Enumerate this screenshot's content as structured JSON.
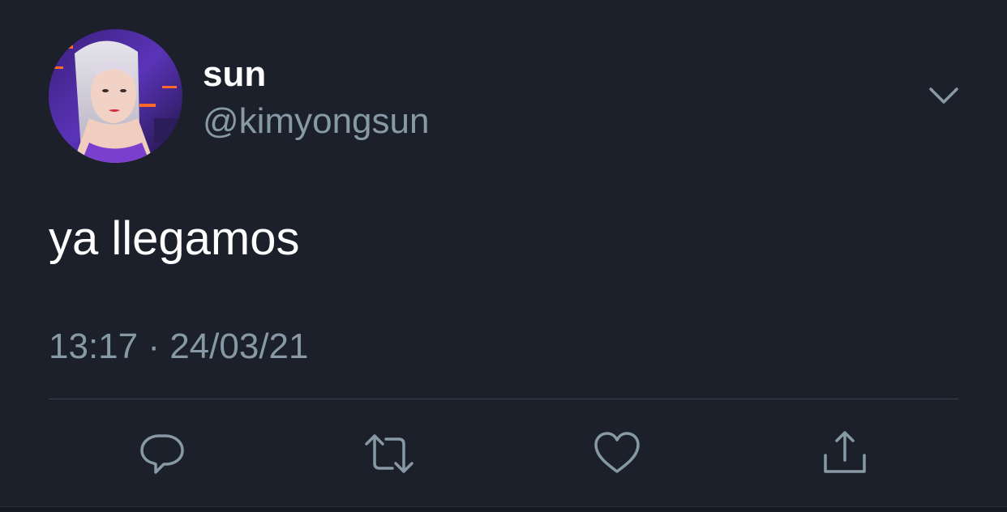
{
  "tweet": {
    "display_name": "sun",
    "handle": "@kimyongsun",
    "text": "ya llegamos",
    "timestamp": "13:17 · 24/03/21"
  },
  "icons": {
    "menu": "chevron-down-icon",
    "reply": "reply-icon",
    "retweet": "retweet-icon",
    "like": "heart-icon",
    "share": "share-icon"
  },
  "colors": {
    "background": "#1b202a",
    "primary_text": "#ffffff",
    "secondary_text": "#8899a6",
    "divider": "#39414d"
  }
}
